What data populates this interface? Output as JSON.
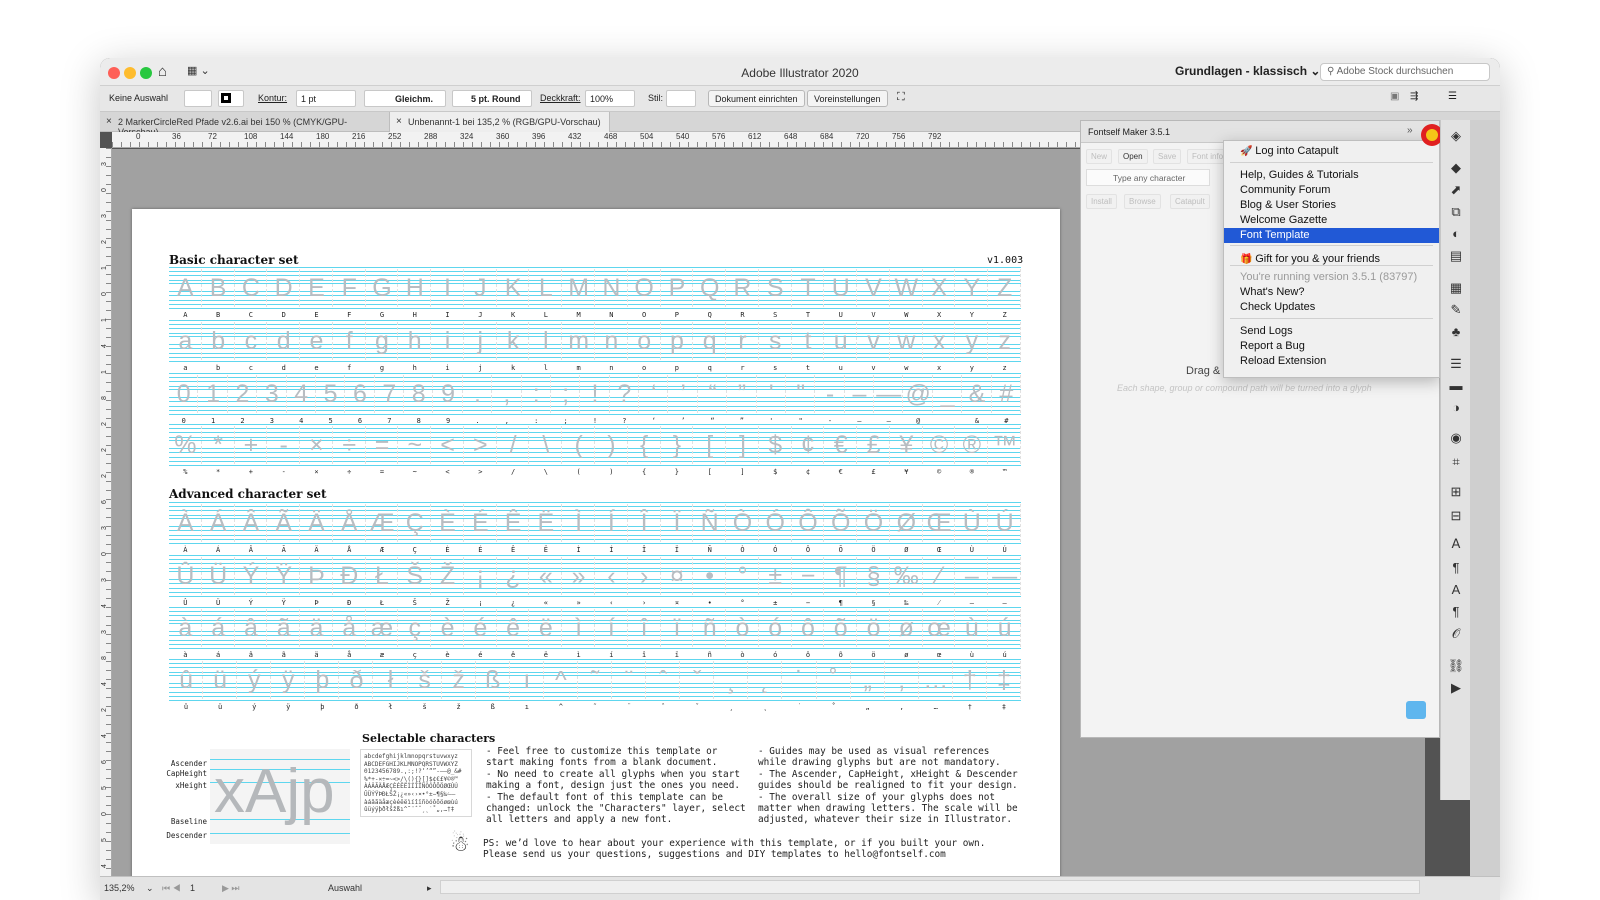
{
  "app": {
    "title": "Adobe Illustrator 2020",
    "workspace": "Grundlagen - klassisch",
    "stock_search": "Adobe Stock durchsuchen"
  },
  "control": {
    "selection": "Keine Auswahl",
    "stroke_label": "Kontur:",
    "stroke_weight": "1 pt",
    "profile": "Gleichm.",
    "brush": "5 pt. Round",
    "opacity_label": "Deckkraft:",
    "opacity": "100%",
    "style_label": "Stil:",
    "doc_setup": "Dokument einrichten",
    "preferences": "Voreinstellungen"
  },
  "tabs": [
    {
      "label": "2 MarkerCircleRed Pfade v2.6.ai bei 150 % (CMYK/GPU-Vorschau)"
    },
    {
      "label": "Unbenannt-1 bei 135,2 % (RGB/GPU-Vorschau)"
    }
  ],
  "ruler": {
    "h": [
      "0",
      "36",
      "72",
      "108",
      "144",
      "180",
      "216",
      "252",
      "288",
      "324",
      "360",
      "396",
      "432",
      "468",
      "504",
      "540",
      "576",
      "612",
      "648",
      "684",
      "720",
      "756",
      "792"
    ],
    "v": [
      "3",
      "0",
      "3",
      "2",
      "1",
      "0",
      "1",
      "4",
      "1",
      "8",
      "2",
      "2",
      "2",
      "6",
      "3",
      "0",
      "3",
      "4",
      "3",
      "8",
      "4",
      "2",
      "4",
      "6",
      "5",
      "0",
      "5",
      "4"
    ]
  },
  "doc": {
    "basic_title": "Basic character set",
    "version": "v1.003",
    "advanced_title": "Advanced character set",
    "selectable_title": "Selectable characters",
    "rows": [
      "A B C D E F G H I J K L M N O P Q R S T U V W X Y Z",
      "a b c d e f g h i j k l m n o p q r s t u v w x y z",
      "0 1 2 3 4 5 6 7 8 9 . , : ; ! ? ‘ ’ “ ” ' \" - – — @ _ & #",
      "% * + - × ÷ = ~ < > / \\ ( ) { } [ ] $ ¢ € £ ¥ © ® ™",
      "À Á Â Ã Ä Å Æ Ç È É Ê Ë Ì Í Î Ï Ñ Ò Ó Ô Õ Ö Ø Œ Ù Ú",
      "Û Ü Ý Ÿ Þ Ð Ł Š Ž ¡ ¿ « » ‹ › ¤ • ° ± − ¶ § ‰ ⁄ ‒ ―",
      "à á â ã ä å æ ç è é ê ë ì í î ï ñ ò ó ô õ ö ø œ ù ú",
      "û ü ý ÿ þ ð ł š ž ß ı ^ ˜ ¨ ˆ ˇ ¸ ˛ ˙ ˚ „ ‚ … † ‡"
    ],
    "metrics": [
      "Ascender",
      "CapHeight",
      "xHeight",
      "Baseline",
      "Descender"
    ],
    "sample_word": "xAjp",
    "sample_lines": [
      "abcdefghijklmnopqrstuvwxyz",
      "ABCDEFGHIJKLMNOPQRSTUVWXYZ",
      "0123456789.,:;!?‘’“”-–—@_&#",
      "%*+-×÷=~<>/\\(){}[]$¢€£¥©®™",
      "ÀÁÂÃÄÅÆÇÈÉÊËÌÍÎÏÑÒÓÔÕÖØŒÙÚ",
      "ÛÜÝŸÞÐŁŠŽ¡¿«»‹›¤•°±−¶§‰⁄‒―",
      "àáâãäåæçèéêëìíîïñòóôõöøœùú",
      "ûüýÿþðłšžßı^˜¨ˆˇ¸˛˙˚„‚…†‡"
    ],
    "notes_left": "- Feel free to customize this template or\nstart making fonts from a blank document.\n- No need to create all glyphs when you start\nmaking a font, design just the ones you need.\n- The default font of this template can be\nchanged: unlock the \"Characters\" layer, select\nall letters and apply a new font.",
    "notes_right": "- Guides may be used as visual references\nwhile drawing glyphs but are not mandatory.\n- The Ascender, CapHeight, xHeight & Descender\nguides should be realigned to fit your design.\n- The overall size of your glyphs does not\nmatter when drawing letters. The scale will be\nadjusted, whatever their size in Illustrator.",
    "ps": "PS: we’d love to hear about your experience with this template, or if you built your own.\nPlease send us your questions, suggestions and DIY templates to hello@fontself.com"
  },
  "panel": {
    "title": "Fontself Maker 3.5.1",
    "buttons": [
      "New",
      "Open",
      "Save",
      "Font info"
    ],
    "buttons2": [
      "Install",
      "Browse",
      "Catapult"
    ],
    "input_placeholder": "Type any character",
    "drag_text": "Drag & drop your letters here",
    "drag_hint": "Each shape, group or compound path will be turned into a glyph"
  },
  "menu": {
    "items": [
      {
        "label": "Log into Catapult",
        "icon": "rocket-icon",
        "glyph": "🚀"
      },
      {
        "label": "Help, Guides & Tutorials"
      },
      {
        "label": "Community Forum"
      },
      {
        "label": "Blog & User Stories"
      },
      {
        "label": "Welcome Gazette"
      },
      {
        "label": "Font Template",
        "selected": true
      },
      {
        "label": "Gift for you & your friends",
        "icon": "gift-icon",
        "glyph": "🎁"
      },
      {
        "label": "You're running version 3.5.1 (83797)",
        "dim": true
      },
      {
        "label": "What's New?"
      },
      {
        "label": "Check Updates"
      },
      {
        "label": "Send Logs"
      },
      {
        "label": "Report a Bug"
      },
      {
        "label": "Reload Extension"
      }
    ]
  },
  "status": {
    "zoom": "135,2%",
    "page": "1",
    "tool": "Auswahl"
  },
  "colors": {
    "accent": "#2159d6",
    "guide": "#5ed6ee",
    "badge": "#e02020"
  },
  "dock_icons": [
    "properties-icon",
    "layers-icon",
    "export-icon",
    "artboards-icon",
    "color-guide-icon",
    "swatches-icon",
    "graphic-styles-icon",
    "brushes-icon",
    "symbols-icon",
    "stroke-icon",
    "gradient-icon",
    "transparency-icon",
    "appearance-icon",
    "transform-icon",
    "align-icon",
    "pathfinder-icon",
    "character-icon",
    "paragraph-icon",
    "character-styles-icon",
    "paragraph-styles-icon",
    "opentype-icon",
    "links-icon",
    "actions-icon"
  ]
}
